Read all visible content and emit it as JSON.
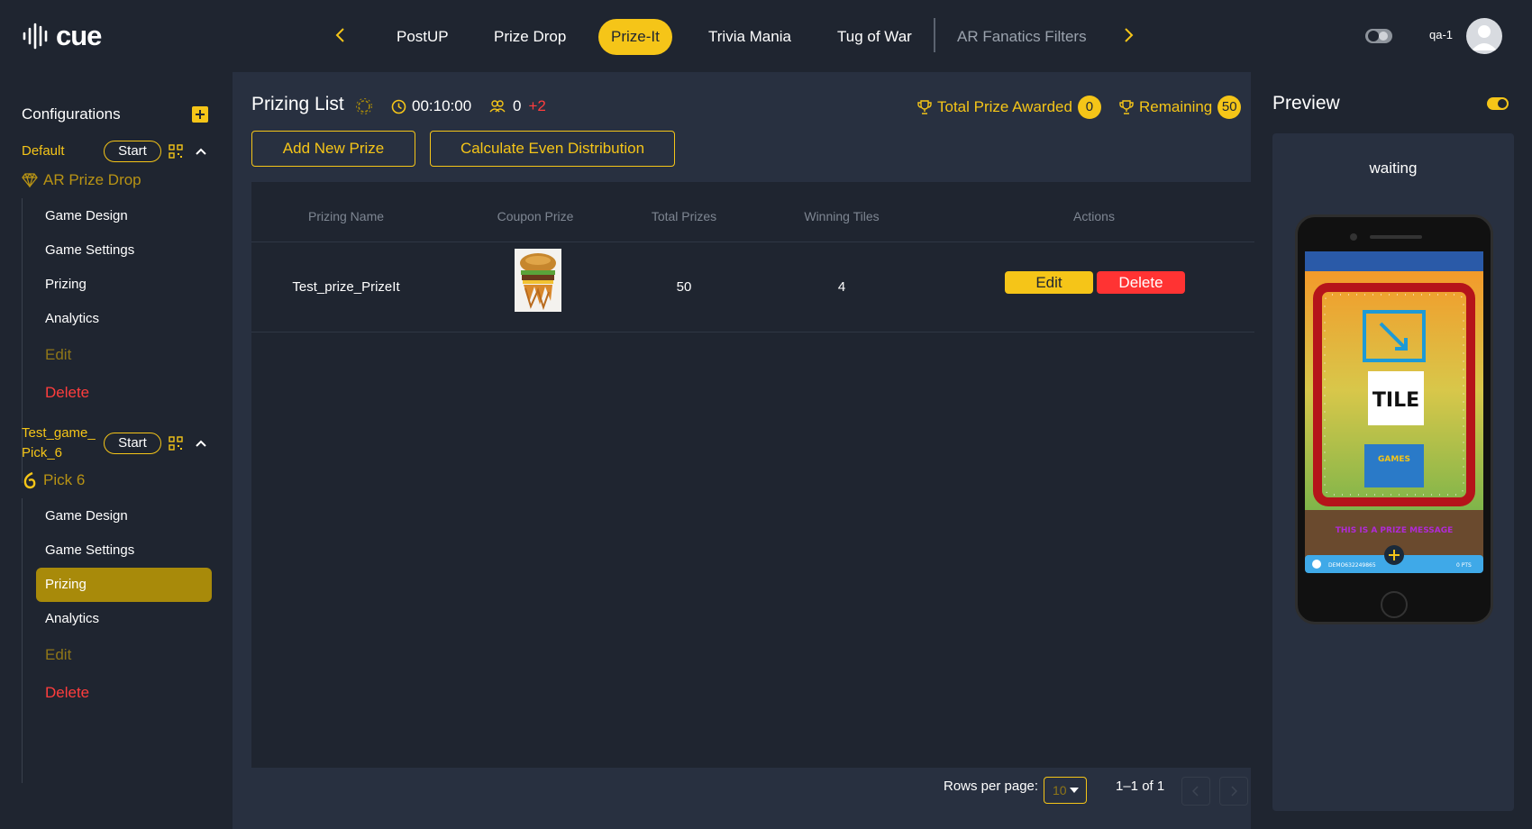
{
  "app": {
    "logo_text": "cue",
    "user": "qa-1"
  },
  "nav": {
    "tabs": [
      {
        "label": "PostUP"
      },
      {
        "label": "Prize Drop"
      },
      {
        "label": "Prize-It"
      },
      {
        "label": "Trivia Mania"
      },
      {
        "label": "Tug of War"
      },
      {
        "label": "AR Fanatics Filters"
      }
    ],
    "active_tab": "Prize-It"
  },
  "sidebar": {
    "title": "Configurations",
    "games": [
      {
        "name": "Default",
        "start_label": "Start",
        "type": "AR Prize Drop",
        "items": [
          "Game Design",
          "Game Settings",
          "Prizing",
          "Analytics",
          "Edit",
          "Delete"
        ]
      },
      {
        "name": "Test_game_ Pick_6",
        "name_line1": "Test_game_",
        "name_line2": "Pick_6",
        "start_label": "Start",
        "type": "Pick 6",
        "items": [
          "Game Design",
          "Game Settings",
          "Prizing",
          "Analytics",
          "Edit",
          "Delete"
        ],
        "active_item": "Prizing"
      }
    ]
  },
  "main": {
    "title": "Prizing List",
    "timer": "00:10:00",
    "players": "0",
    "players_delta": "+2",
    "total_awarded_label": "Total Prize Awarded",
    "total_awarded": "0",
    "remaining_label": "Remaining",
    "remaining": "50",
    "add_button": "Add New Prize",
    "distribute_button": "Calculate Even Distribution",
    "table": {
      "columns": [
        "Prizing Name",
        "Coupon Prize",
        "Total Prizes",
        "Winning Tiles",
        "Actions"
      ],
      "rows": [
        {
          "name": "Test_prize_PrizeIt",
          "total": "50",
          "winning_tiles": "4",
          "edit": "Edit",
          "delete": "Delete"
        }
      ]
    },
    "pagination": {
      "rows_label": "Rows per page:",
      "rows_value": "10",
      "range": "1–1 of 1"
    }
  },
  "preview": {
    "title": "Preview",
    "status": "waiting",
    "screen": {
      "tile_text": "TILE",
      "games_text": "GAMES",
      "banner": "THIS IS A PRIZE MESSAGE",
      "user_id": "DEMO632249865",
      "points": "0 PTS"
    }
  },
  "colors": {
    "accent": "#f5c518",
    "danger": "#ff3333",
    "bg": "#1f2530",
    "panel": "#283040"
  }
}
